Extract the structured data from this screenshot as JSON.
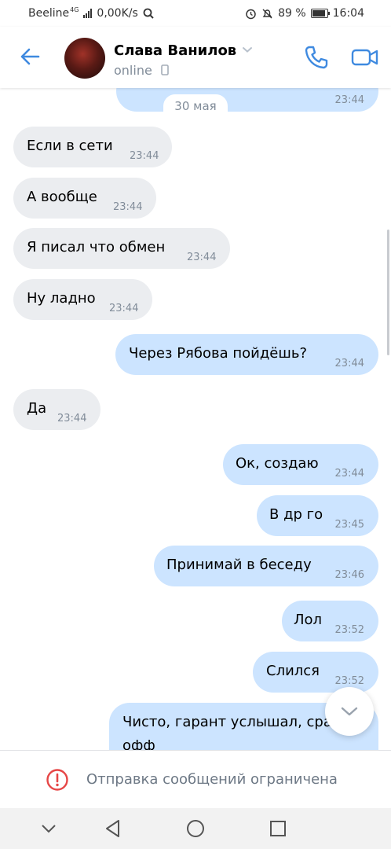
{
  "status_bar": {
    "carrier": "Beeline",
    "network": "4G",
    "speed": "0,00K/s",
    "battery": "89 %",
    "battery_level": 0.89,
    "time": "16:04"
  },
  "header": {
    "contact_name": "Слава Ванилов",
    "status": "online"
  },
  "date_chip": "30 мая",
  "messages": [
    {
      "dir": "out",
      "text": "",
      "time": "23:44"
    },
    {
      "dir": "in",
      "text": "Если в сети",
      "time": "23:44"
    },
    {
      "dir": "in",
      "text": "А вообще",
      "time": "23:44"
    },
    {
      "dir": "in",
      "text": "Я писал что обмен",
      "time": "23:44"
    },
    {
      "dir": "in",
      "text": "Ну ладно",
      "time": "23:44"
    },
    {
      "dir": "out",
      "text": "Через Рябова пойдёшь?",
      "time": "23:44"
    },
    {
      "dir": "in",
      "text": "Да",
      "time": "23:44"
    },
    {
      "dir": "out",
      "text": "Ок, создаю",
      "time": "23:44"
    },
    {
      "dir": "out",
      "text": "В др го",
      "time": "23:45"
    },
    {
      "dir": "out",
      "text": "Принимай в беседу",
      "time": "23:46"
    },
    {
      "dir": "out",
      "text": "Лол",
      "time": "23:52"
    },
    {
      "dir": "out",
      "text": "Слился",
      "time": "23:52"
    },
    {
      "dir": "out",
      "text": "Чисто, гарант услышал, сра",
      "text2": "офф",
      "time": ""
    }
  ],
  "restricted_notice": "Отправка сообщений ограничена",
  "colors": {
    "accent": "#3f8ae0",
    "incoming_bubble": "#ebedf0",
    "outgoing_bubble": "#cce4ff",
    "warning": "#e64646",
    "secondary_text": "#818c99"
  },
  "icons": {
    "back": "arrow-left",
    "call": "phone",
    "video": "video-camera",
    "scroll_down": "chevron-down",
    "warning": "exclamation-circle",
    "nav": [
      "chevron-down",
      "triangle-back",
      "circle-home",
      "square-recents"
    ]
  }
}
